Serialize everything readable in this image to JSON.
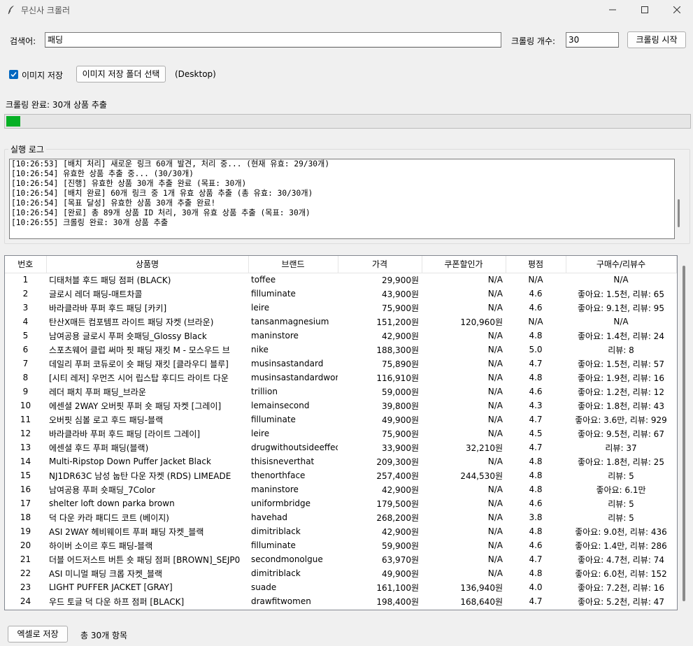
{
  "window": {
    "title": "무신사 크롤러"
  },
  "search": {
    "label": "검색어:",
    "value": "패딩"
  },
  "count": {
    "label": "크롤링 개수:",
    "value": "30"
  },
  "start_button": "크롤링 시작",
  "image_save": {
    "checkbox_label": "이미지 저장",
    "checked": true,
    "folder_button": "이미지 저장 폴더 선택",
    "folder_path": "(Desktop)"
  },
  "status_text": "크롤링 완료: 30개 상품 추출",
  "progress": {
    "fraction": 0.02,
    "color": "#06b025"
  },
  "log": {
    "title": "실행 로그",
    "lines": [
      "[10:26:53] [배치 처리] 새로운 링크 60개 발견, 처리 중... (현재 유효: 29/30개)",
      "[10:26:54] 유효한 상품 추출 중... (30/30개)",
      "[10:26:54] [진행] 유효한 상품 30개 추출 완료 (목표: 30개)",
      "[10:26:54] [배치 완료] 60개 링크 중 1개 유효 상품 추출 (총 유효: 30/30개)",
      "[10:26:54] [목표 달성] 유효한 상품 30개 추출 완료!",
      "[10:26:54] [완료] 총 89개 상품 ID 처리, 30개 유효 상품 추출 (목표: 30개)",
      "[10:26:55] 크롤링 완료: 30개 상품 추출"
    ]
  },
  "table": {
    "headers": [
      "번호",
      "상품명",
      "브랜드",
      "가격",
      "쿠폰할인가",
      "평점",
      "구매수/리뷰수"
    ],
    "rows": [
      [
        "1",
        "디태처블 후드 패딩 점퍼 (BLACK)",
        "toffee",
        "29,900원",
        "N/A",
        "N/A",
        "N/A"
      ],
      [
        "2",
        "글로시 레더 패딩-매트차콜",
        "filluminate",
        "43,900원",
        "N/A",
        "4.6",
        "좋아요: 1.5천, 리뷰: 65"
      ],
      [
        "3",
        "바라클라바 푸퍼 후드 패딩 [카키]",
        "leire",
        "75,900원",
        "N/A",
        "4.6",
        "좋아요: 9.1천, 리뷰: 95"
      ],
      [
        "4",
        "탄산X매든 컴포템프 라이트 패딩 자켓 (브라운)",
        "tansanmagnesium",
        "151,200원",
        "120,960원",
        "N/A",
        "N/A"
      ],
      [
        "5",
        "남여공용 글로시 푸퍼 숏패딩_Glossy Black",
        "maninstore",
        "42,900원",
        "N/A",
        "4.8",
        "좋아요: 1.4천, 리뷰: 24"
      ],
      [
        "6",
        "스포츠웨어 클럽 써마 핏 패딩 재킷 M - 모스우드 브",
        "nike",
        "188,300원",
        "N/A",
        "5.0",
        "리뷰: 8"
      ],
      [
        "7",
        "데일리 푸퍼 코듀로이 숏 패딩 재킷 [클라우디 블루]",
        "musinsastandard",
        "75,890원",
        "N/A",
        "4.7",
        "좋아요: 1.5천, 리뷰: 57"
      ],
      [
        "8",
        "[시티 레저] 우먼즈 시어 립스탑 후디드 라이트 다운",
        "musinsastandardwoman",
        "116,910원",
        "N/A",
        "4.8",
        "좋아요: 1.9천, 리뷰: 16"
      ],
      [
        "9",
        "레더 패치 푸퍼 패딩_브라운",
        "trillion",
        "59,000원",
        "N/A",
        "4.6",
        "좋아요: 1.2천, 리뷰: 12"
      ],
      [
        "10",
        "에센셜 2WAY 오버핏 푸퍼 숏 패딩 자켓 [그레이]",
        "lemainsecond",
        "39,800원",
        "N/A",
        "4.3",
        "좋아요: 1.8천, 리뷰: 43"
      ],
      [
        "11",
        "오버핏 심볼 로고 후드 패딩-블랙",
        "filluminate",
        "49,900원",
        "N/A",
        "4.7",
        "좋아요: 3.6만, 리뷰: 929"
      ],
      [
        "12",
        "바라클라바 푸퍼 후드 패딩 [라이트 그레이]",
        "leire",
        "75,900원",
        "N/A",
        "4.5",
        "좋아요: 9.5천, 리뷰: 67"
      ],
      [
        "13",
        "에센셜 후드 푸퍼 패딩(블랙)",
        "drugwithoutsideeffect",
        "33,900원",
        "32,210원",
        "4.7",
        "리뷰: 37"
      ],
      [
        "14",
        "Multi-Ripstop Down Puffer Jacket Black",
        "thisisneverthat",
        "209,300원",
        "N/A",
        "4.8",
        "좋아요: 1.8천, 리뷰: 25"
      ],
      [
        "15",
        "NJ1DR63C 남성 눕탄 다운 자켓 (RDS) LIMEADE",
        "thenorthface",
        "257,400원",
        "244,530원",
        "4.8",
        "리뷰: 5"
      ],
      [
        "16",
        "남여공용 푸퍼 숏패딩_7Color",
        "maninstore",
        "42,900원",
        "N/A",
        "4.8",
        "좋아요: 6.1만"
      ],
      [
        "17",
        "shelter loft down parka brown",
        "uniformbridge",
        "179,500원",
        "N/A",
        "4.6",
        "리뷰: 5"
      ],
      [
        "18",
        "덕 다운 카라 패디드 코트 (베이지)",
        "havehad",
        "268,200원",
        "N/A",
        "3.8",
        "리뷰: 5"
      ],
      [
        "19",
        "ASI 2WAY 헤비웨이트 푸퍼 패딩 자켓_블랙",
        "dimitriblack",
        "42,900원",
        "N/A",
        "4.8",
        "좋아요: 9.0천, 리뷰: 436"
      ],
      [
        "20",
        "하이버 소이르 후드 패딩-블랙",
        "filluminate",
        "59,900원",
        "N/A",
        "4.6",
        "좋아요: 1.4만, 리뷰: 286"
      ],
      [
        "21",
        "더블 어드저스트 버튼 숏 패딩 점퍼 [BROWN]_SEJP0",
        "secondmonolgue",
        "63,970원",
        "N/A",
        "4.7",
        "좋아요: 4.7천, 리뷰: 74"
      ],
      [
        "22",
        "ASI 미니멀 패딩 크롭 자켓_블랙",
        "dimitriblack",
        "49,900원",
        "N/A",
        "4.8",
        "좋아요: 6.0천, 리뷰: 152"
      ],
      [
        "23",
        "LIGHT PUFFER JACKET [GRAY]",
        "suade",
        "161,100원",
        "136,940원",
        "4.0",
        "좋아요: 7.2천, 리뷰: 16"
      ],
      [
        "24",
        "우드 토글 덕 다운 하프 점퍼 [BLACK]",
        "drawfitwomen",
        "198,400원",
        "168,640원",
        "4.7",
        "좋아요: 5.2천, 리뷰: 47"
      ]
    ]
  },
  "footer": {
    "excel_button": "엑셀로 저장",
    "total_text": "총 30개 항목"
  }
}
